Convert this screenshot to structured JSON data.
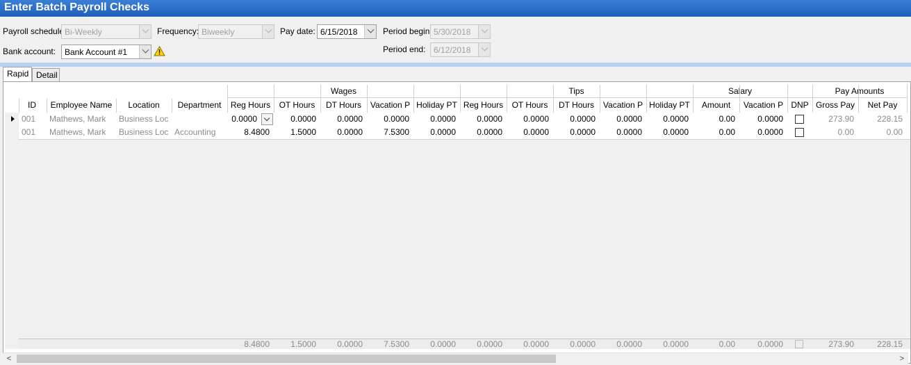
{
  "title": "Enter Batch Payroll Checks",
  "form": {
    "payroll_schedule_label": "Payroll schedule:",
    "payroll_schedule_value": "Bi-Weekly",
    "frequency_label": "Frequency:",
    "frequency_value": "Biweekly",
    "pay_date_label": "Pay date:",
    "pay_date_value": "6/15/2018",
    "period_begin_label": "Period begin:",
    "period_begin_value": "5/30/2018",
    "period_end_label": "Period end:",
    "period_end_value": "6/12/2018",
    "bank_account_label": "Bank account:",
    "bank_account_value": "Bank Account #1"
  },
  "tabs": [
    "Rapid",
    "Detail"
  ],
  "groups": {
    "wages": "Wages",
    "tips": "Tips",
    "salary": "Salary",
    "pay_amounts": "Pay Amounts"
  },
  "columns": [
    "ID",
    "Employee Name",
    "Location",
    "Department",
    "Reg Hours",
    "OT Hours",
    "DT Hours",
    "Vacation P",
    "Holiday PT",
    "Reg Hours",
    "OT Hours",
    "DT Hours",
    "Vacation P",
    "Holiday PT",
    "Amount",
    "Vacation P",
    "DNP",
    "Gross Pay",
    "Net Pay"
  ],
  "rows": [
    {
      "id": "001",
      "name": "Mathews, Mark",
      "location": "Business Loc",
      "department": "",
      "values": [
        "0.0000",
        "0.0000",
        "0.0000",
        "0.0000",
        "0.0000",
        "0.0000",
        "0.0000",
        "0.0000",
        "0.0000",
        "0.0000",
        "0.00",
        "0.0000"
      ],
      "gross": "273.90",
      "net": "228.15"
    },
    {
      "id": "001",
      "name": "Mathews, Mark",
      "location": "Business Loc",
      "department": "Accounting",
      "values": [
        "8.4800",
        "1.5000",
        "0.0000",
        "7.5300",
        "0.0000",
        "0.0000",
        "0.0000",
        "0.0000",
        "0.0000",
        "0.0000",
        "0.00",
        "0.0000"
      ],
      "gross": "0.00",
      "net": "0.00"
    }
  ],
  "totals": {
    "values": [
      "8.4800",
      "1.5000",
      "0.0000",
      "7.5300",
      "0.0000",
      "0.0000",
      "0.0000",
      "0.0000",
      "0.0000",
      "0.0000",
      "0.00",
      "0.0000"
    ],
    "gross": "273.90",
    "net": "228.15"
  },
  "colors": {
    "title_bar": "#1f5fbe",
    "accent_strip": "#b9d1ee"
  }
}
